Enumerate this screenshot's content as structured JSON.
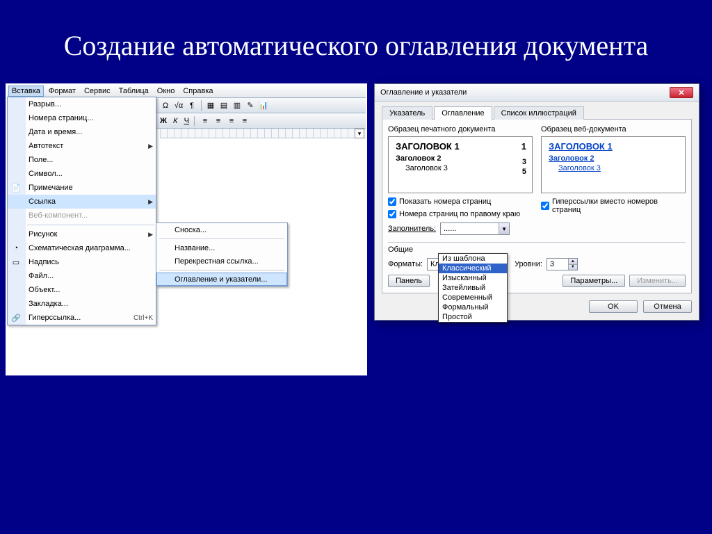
{
  "slide": {
    "title": "Создание автоматического оглавления документа"
  },
  "menubar": [
    "Вставка",
    "Формат",
    "Сервис",
    "Таблица",
    "Окно",
    "Справка"
  ],
  "menu": {
    "items": [
      {
        "label": "Разрыв...",
        "icon": ""
      },
      {
        "label": "Номера страниц...",
        "icon": ""
      },
      {
        "label": "Дата и время...",
        "icon": ""
      },
      {
        "label": "Автотекст",
        "icon": "",
        "arrow": true
      },
      {
        "label": "Поле...",
        "icon": ""
      },
      {
        "label": "Символ...",
        "icon": ""
      },
      {
        "label": "Примечание",
        "icon": "📄"
      },
      {
        "label": "Ссылка",
        "icon": "",
        "arrow": true,
        "hover": true
      },
      {
        "label": "Веб-компонент...",
        "icon": "",
        "disabled": true
      },
      {
        "label": "Рисунок",
        "icon": "",
        "arrow": true
      },
      {
        "label": "Схематическая диаграмма...",
        "icon": "◔"
      },
      {
        "label": "Надпись",
        "icon": "▭"
      },
      {
        "label": "Файл...",
        "icon": ""
      },
      {
        "label": "Объект...",
        "icon": ""
      },
      {
        "label": "Закладка...",
        "icon": ""
      },
      {
        "label": "Гиперссылка...",
        "icon": "🔗",
        "shortcut": "Ctrl+K"
      }
    ],
    "submenu": [
      {
        "label": "Сноска..."
      },
      {
        "label": "Название..."
      },
      {
        "label": "Перекрестная ссылка..."
      },
      {
        "label": "Оглавление и указатели...",
        "hover": true
      }
    ]
  },
  "dialog": {
    "title": "Оглавление и указатели",
    "tabs": [
      "Указатель",
      "Оглавление",
      "Список иллюстраций"
    ],
    "active_tab": 1,
    "print_label": "Образец печатного документа",
    "web_label": "Образец веб-документа",
    "sample": {
      "h1": "ЗАГОЛОВОК 1",
      "p1": "1",
      "h2": "Заголовок 2",
      "p2": "3",
      "h3": "Заголовок 3",
      "p3": "5"
    },
    "chk1": "Показать номера страниц",
    "chk2": "Номера страниц по правому краю",
    "chk3": "Гиперссылки вместо номеров страниц",
    "filler_label": "Заполнитель:",
    "filler_value": "......",
    "general_label": "Общие",
    "formats_label": "Форматы:",
    "formats_value": "Классический",
    "levels_label": "Уровни:",
    "levels_value": "3",
    "panel_btn": "Панель",
    "params_btn": "Параметры...",
    "modify_btn": "Изменить...",
    "ok": "OK",
    "cancel": "Отмена",
    "format_options": [
      "Из шаблона",
      "Классический",
      "Изысканный",
      "Затейливый",
      "Современный",
      "Формальный",
      "Простой"
    ]
  }
}
